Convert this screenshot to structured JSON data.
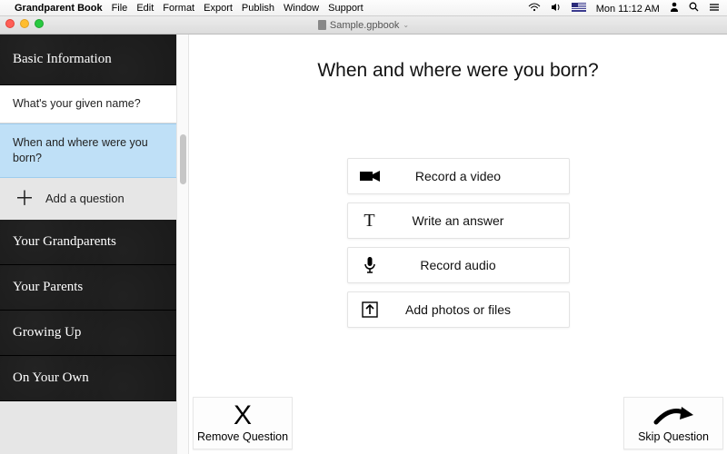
{
  "menubar": {
    "app_name": "Grandparent Book",
    "items": [
      "File",
      "Edit",
      "Format",
      "Export",
      "Publish",
      "Window",
      "Support"
    ],
    "clock": "Mon 11:12 AM"
  },
  "titlebar": {
    "document": "Sample.gpbook"
  },
  "sidebar": {
    "sections": [
      {
        "title": "Basic Information",
        "expanded": true,
        "questions": [
          {
            "text": "What's your given name?",
            "selected": false
          },
          {
            "text": "When and where were you born?",
            "selected": true
          }
        ],
        "add_label": "Add a question"
      },
      {
        "title": "Your Grandparents"
      },
      {
        "title": "Your Parents"
      },
      {
        "title": "Growing Up"
      },
      {
        "title": "On Your Own"
      }
    ]
  },
  "main": {
    "question": "When and where were you born?",
    "actions": [
      {
        "icon": "video-icon",
        "label": "Record a video"
      },
      {
        "icon": "text-icon",
        "label": "Write an answer"
      },
      {
        "icon": "mic-icon",
        "label": "Record audio"
      },
      {
        "icon": "upload-icon",
        "label": "Add photos or files"
      }
    ],
    "remove_label": "Remove Question",
    "skip_label": "Skip Question"
  }
}
